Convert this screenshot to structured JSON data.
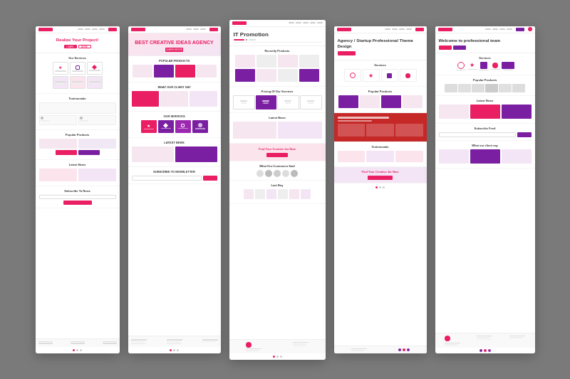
{
  "cards": [
    {
      "id": "card1",
      "title": "Realize Your Project!",
      "hero_btn1": "LEARN",
      "hero_btn2": "MORE",
      "sections": [
        {
          "label": "Our Services"
        },
        {
          "label": "Testimonials"
        },
        {
          "label": "Popular Products"
        },
        {
          "label": "Latest News"
        },
        {
          "label": "Subscribe To News"
        }
      ]
    },
    {
      "id": "card2",
      "title": "BEST CREATIVE IDEAS AGENCY",
      "sections": [
        {
          "label": "POPULAR PRODUCTS"
        },
        {
          "label": "WHAT OUR CLIENT SAY"
        },
        {
          "label": "OUR SERVICES"
        },
        {
          "label": "LATEST NEWS"
        },
        {
          "label": "SUBSCRIBE TO NEWSLETTER"
        }
      ]
    },
    {
      "id": "card3",
      "title": "IT Promotion",
      "sections": [
        {
          "label": "Recently Products"
        },
        {
          "label": "Pricing Of Our Services"
        },
        {
          "label": "Latest News"
        },
        {
          "label": "Find Your Creative Jar Now"
        },
        {
          "label": "What Our Customers Said"
        },
        {
          "label": "Last Buy"
        }
      ]
    },
    {
      "id": "card4",
      "title": "Agency / Startup Professional Theme Design",
      "sections": [
        {
          "label": "Services"
        },
        {
          "label": "Popular Products"
        },
        {
          "label": "Testimonials"
        },
        {
          "label": "Find Your Creative Jar Now"
        }
      ]
    },
    {
      "id": "card5",
      "title": "Welcome to professional team",
      "sections": [
        {
          "label": "Services"
        },
        {
          "label": "Popular Products"
        },
        {
          "label": "Latest News"
        },
        {
          "label": "Subscribe Feed"
        },
        {
          "label": "What our client say"
        }
      ]
    }
  ]
}
